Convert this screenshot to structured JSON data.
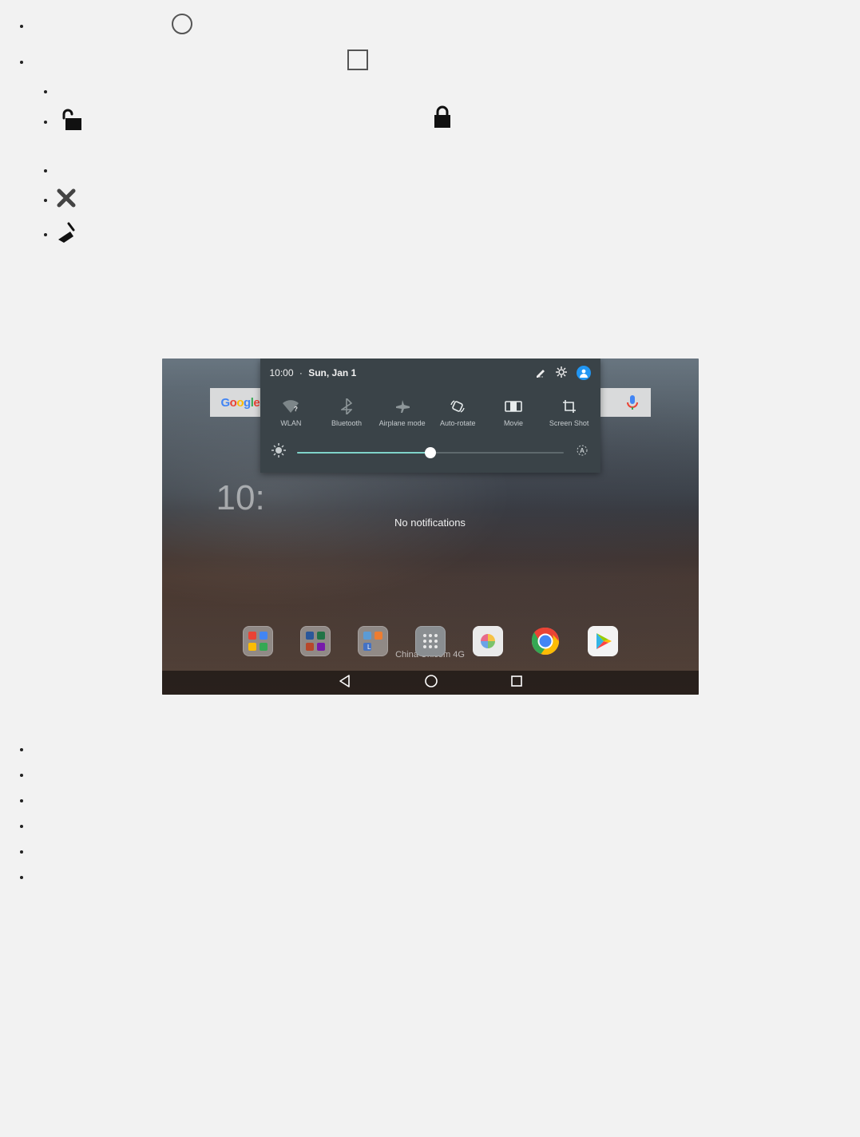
{
  "shade": {
    "time": "10:00",
    "sep": "·",
    "date": "Sun, Jan 1",
    "tiles": [
      {
        "label": "WLAN"
      },
      {
        "label": "Bluetooth"
      },
      {
        "label": "Airplane mode"
      },
      {
        "label": "Auto-rotate"
      },
      {
        "label": "Movie"
      },
      {
        "label": "Screen Shot"
      }
    ],
    "brightness_pct": 50
  },
  "notifications": {
    "empty_label": "No notifications"
  },
  "home": {
    "clock": "10:",
    "carrier": "China Unicom 4G",
    "search_brand": "Google"
  }
}
